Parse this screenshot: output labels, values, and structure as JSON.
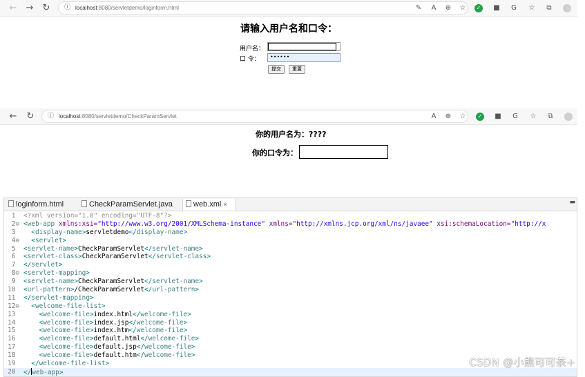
{
  "browser1": {
    "url_host": "localhost",
    "url_rest": ":8080/servletdemo/loginform.html",
    "info_icon": "info-icon"
  },
  "form": {
    "title": "请输入用户名和口令：",
    "username_label": "用户名：",
    "password_label": "口 令：",
    "password_value": "••••••",
    "submit_label": "提交",
    "reset_label": "重置"
  },
  "browser2": {
    "url_host": "localhost",
    "url_rest": ":8080/servletdemo/CheckParamServlet"
  },
  "result": {
    "username_line": "你的用户名为：????",
    "password_label": "你的口令为："
  },
  "editor": {
    "tabs": [
      {
        "label": "loginform.html"
      },
      {
        "label": "CheckParamServlet.java"
      },
      {
        "label": "web.xml",
        "close": "×"
      }
    ],
    "lines": [
      {
        "num": "1",
        "fold": ""
      },
      {
        "num": "2",
        "fold": "⊖"
      },
      {
        "num": "3",
        "fold": ""
      },
      {
        "num": "4",
        "fold": "⊖"
      },
      {
        "num": "5",
        "fold": ""
      },
      {
        "num": "6",
        "fold": ""
      },
      {
        "num": "7",
        "fold": ""
      },
      {
        "num": "8",
        "fold": "⊖"
      },
      {
        "num": "9",
        "fold": ""
      },
      {
        "num": "10",
        "fold": ""
      },
      {
        "num": "11",
        "fold": ""
      },
      {
        "num": "12",
        "fold": "⊖"
      },
      {
        "num": "13",
        "fold": ""
      },
      {
        "num": "14",
        "fold": ""
      },
      {
        "num": "15",
        "fold": ""
      },
      {
        "num": "16",
        "fold": ""
      },
      {
        "num": "17",
        "fold": ""
      },
      {
        "num": "18",
        "fold": ""
      },
      {
        "num": "19",
        "fold": ""
      },
      {
        "num": "20",
        "fold": ""
      }
    ],
    "code": {
      "l1_pi": "<?xml version=\"1.0\" encoding=\"UTF-8\"?>",
      "l2_open": "<web-app",
      "l2_a1": " xmlns:xsi=",
      "l2_v1": "\"http://www.w3.org/2001/XMLSchema-instance\"",
      "l2_a2": " xmlns=",
      "l2_v2": "\"http://xmlns.jcp.org/xml/ns/javaee\"",
      "l2_a3": " xsi:schemaLocation=",
      "l2_v3": "\"http://x",
      "display_name_tag": "display-name",
      "display_name_val": "servletdemo",
      "servlet_tag": "servlet",
      "servlet_name_tag": "servlet-name",
      "servlet_name_val": "CheckParamServlet",
      "servlet_class_tag": "servlet-class",
      "servlet_class_val": "CheckParamServlet",
      "servlet_mapping_tag": "servlet-mapping",
      "url_pattern_tag": "url-pattern",
      "url_pattern_val": "/CheckParamServlet",
      "welcome_list_tag": "welcome-file-list",
      "welcome_file_tag": "welcome-file",
      "welcome_files": [
        "index.html",
        "index.jsp",
        "index.htm",
        "default.html",
        "default.jsp",
        "default.htm"
      ],
      "web_app_tag": "web-app"
    }
  },
  "watermark": "CSDN @小熊可可茶+"
}
